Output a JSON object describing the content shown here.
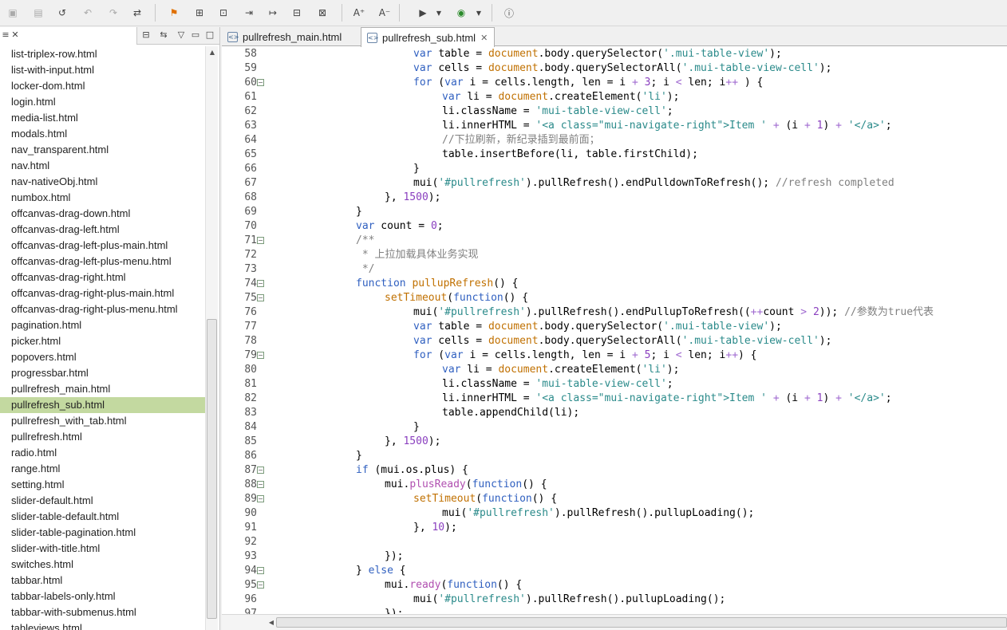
{
  "toolbar": {
    "icons": [
      "save-icon",
      "save-all-icon",
      "revert-icon",
      "undo-icon",
      "redo-icon",
      "format-icon",
      "bookmark-icon",
      "new-file-icon",
      "export-icon",
      "step-in-icon",
      "step-out-icon",
      "terminal-icon",
      "disabled-icon",
      "font-increase-icon",
      "font-decrease-icon",
      "run-icon",
      "browser-icon",
      "info-icon"
    ],
    "glyph_increase": "A⁺",
    "glyph_decrease": "A⁻"
  },
  "left": {
    "files": [
      "list-triplex-row.html",
      "list-with-input.html",
      "locker-dom.html",
      "login.html",
      "media-list.html",
      "modals.html",
      "nav_transparent.html",
      "nav.html",
      "nav-nativeObj.html",
      "numbox.html",
      "offcanvas-drag-down.html",
      "offcanvas-drag-left.html",
      "offcanvas-drag-left-plus-main.html",
      "offcanvas-drag-left-plus-menu.html",
      "offcanvas-drag-right.html",
      "offcanvas-drag-right-plus-main.html",
      "offcanvas-drag-right-plus-menu.html",
      "pagination.html",
      "picker.html",
      "popovers.html",
      "progressbar.html",
      "pullrefresh_main.html",
      "pullrefresh_sub.html",
      "pullrefresh_with_tab.html",
      "pullrefresh.html",
      "radio.html",
      "range.html",
      "setting.html",
      "slider-default.html",
      "slider-table-default.html",
      "slider-table-pagination.html",
      "slider-with-title.html",
      "switches.html",
      "tabbar.html",
      "tabbar-labels-only.html",
      "tabbar-with-submenus.html",
      "tableviews.html"
    ],
    "selected": 22
  },
  "editor": {
    "tabs": [
      "pullrefresh_main.html",
      "pullrefresh_sub.html"
    ],
    "active_tab": 1,
    "lines": [
      {
        "n": "58",
        "fold": false,
        "i": 10,
        "t": [
          [
            "k",
            "var"
          ],
          [
            "",
            "table = "
          ],
          [
            "f",
            "document"
          ],
          [
            "",
            ".body.querySelector("
          ],
          [
            "s",
            "'.mui-table-view'"
          ],
          [
            "",
            ");"
          ]
        ]
      },
      {
        "n": "59",
        "fold": false,
        "i": 10,
        "t": [
          [
            "k",
            "var"
          ],
          [
            "",
            "cells = "
          ],
          [
            "f",
            "document"
          ],
          [
            "",
            ".body.querySelectorAll("
          ],
          [
            "s",
            "'.mui-table-view-cell'"
          ],
          [
            "",
            ");"
          ]
        ]
      },
      {
        "n": "60",
        "fold": true,
        "i": 10,
        "t": [
          [
            "k",
            "for"
          ],
          [
            "",
            " ("
          ],
          [
            "k",
            "var"
          ],
          [
            "",
            " i = cells.length, len = i "
          ],
          [
            "o",
            "+"
          ],
          [
            "",
            " "
          ],
          [
            "n",
            "3"
          ],
          [
            "",
            "; i "
          ],
          [
            "o",
            "<"
          ],
          [
            "",
            " len; i"
          ],
          [
            "o",
            "++"
          ],
          [
            "",
            " ) {"
          ]
        ]
      },
      {
        "n": "61",
        "fold": false,
        "i": 12,
        "t": [
          [
            "k",
            "var"
          ],
          [
            "",
            "li = "
          ],
          [
            "f",
            "document"
          ],
          [
            "",
            ".createElement("
          ],
          [
            "s",
            "'li'"
          ],
          [
            "",
            ");"
          ]
        ]
      },
      {
        "n": "62",
        "fold": false,
        "i": 12,
        "t": [
          [
            "",
            "li.className = "
          ],
          [
            "s",
            "'mui-table-view-cell'"
          ],
          [
            "",
            ";"
          ]
        ]
      },
      {
        "n": "63",
        "fold": false,
        "i": 12,
        "t": [
          [
            "",
            "li.innerHTML = "
          ],
          [
            "s",
            "'<a class=\"mui-navigate-right\">Item '"
          ],
          [
            "",
            " "
          ],
          [
            "o",
            "+"
          ],
          [
            "",
            " (i "
          ],
          [
            "o",
            "+"
          ],
          [
            "",
            " "
          ],
          [
            "n",
            "1"
          ],
          [
            "",
            ") "
          ],
          [
            "o",
            "+"
          ],
          [
            "",
            " "
          ],
          [
            "s",
            "'</a>'"
          ],
          [
            "",
            ";"
          ]
        ]
      },
      {
        "n": "64",
        "fold": false,
        "i": 12,
        "t": [
          [
            "c",
            "//下拉刷新，新纪录插到最前面；"
          ]
        ]
      },
      {
        "n": "65",
        "fold": false,
        "i": 12,
        "t": [
          [
            "",
            "table.insertBefore(li, table.firstChild);"
          ]
        ]
      },
      {
        "n": "66",
        "fold": false,
        "i": 10,
        "t": [
          [
            "",
            "}"
          ]
        ]
      },
      {
        "n": "67",
        "fold": false,
        "i": 10,
        "t": [
          [
            "",
            "mui("
          ],
          [
            "s",
            "'#pullrefresh'"
          ],
          [
            "",
            ").pullRefresh().endPulldownToRefresh(); "
          ],
          [
            "c",
            "//refresh completed"
          ]
        ]
      },
      {
        "n": "68",
        "fold": false,
        "i": 8,
        "t": [
          [
            "",
            "}, "
          ],
          [
            "n",
            "1500"
          ],
          [
            "",
            ");"
          ]
        ]
      },
      {
        "n": "69",
        "fold": false,
        "i": 6,
        "t": [
          [
            "",
            "}"
          ]
        ]
      },
      {
        "n": "70",
        "fold": false,
        "i": 6,
        "t": [
          [
            "k",
            "var"
          ],
          [
            "",
            " count = "
          ],
          [
            "n",
            "0"
          ],
          [
            "",
            ";"
          ]
        ]
      },
      {
        "n": "71",
        "fold": true,
        "i": 6,
        "t": [
          [
            "c",
            "/**"
          ]
        ]
      },
      {
        "n": "72",
        "fold": false,
        "i": 6,
        "t": [
          [
            "c",
            " * 上拉加载具体业务实现"
          ]
        ]
      },
      {
        "n": "73",
        "fold": false,
        "i": 6,
        "t": [
          [
            "c",
            " */"
          ]
        ]
      },
      {
        "n": "74",
        "fold": true,
        "i": 6,
        "t": [
          [
            "k",
            "function"
          ],
          [
            "",
            " "
          ],
          [
            "f",
            "pullupRefresh"
          ],
          [
            "",
            "() {"
          ]
        ]
      },
      {
        "n": "75",
        "fold": true,
        "i": 8,
        "t": [
          [
            "f",
            "setTimeout"
          ],
          [
            "",
            "("
          ],
          [
            "k",
            "function"
          ],
          [
            "",
            "() {"
          ]
        ]
      },
      {
        "n": "76",
        "fold": false,
        "i": 10,
        "t": [
          [
            "",
            "mui("
          ],
          [
            "s",
            "'#pullrefresh'"
          ],
          [
            "",
            ").pullRefresh().endPullupToRefresh(("
          ],
          [
            "o",
            "++"
          ],
          [
            "",
            "count "
          ],
          [
            "o",
            ">"
          ],
          [
            "",
            " "
          ],
          [
            "n",
            "2"
          ],
          [
            "",
            "));"
          ],
          [
            "",
            " "
          ],
          [
            "c",
            "//参数为true代表"
          ]
        ]
      },
      {
        "n": "77",
        "fold": false,
        "i": 10,
        "t": [
          [
            "k",
            "var"
          ],
          [
            "",
            " table = "
          ],
          [
            "f",
            "document"
          ],
          [
            "",
            ".body.querySelector("
          ],
          [
            "s",
            "'.mui-table-view'"
          ],
          [
            "",
            ");"
          ]
        ]
      },
      {
        "n": "78",
        "fold": false,
        "i": 10,
        "t": [
          [
            "k",
            "var"
          ],
          [
            "",
            " cells = "
          ],
          [
            "f",
            "document"
          ],
          [
            "",
            ".body.querySelectorAll("
          ],
          [
            "s",
            "'.mui-table-view-cell'"
          ],
          [
            "",
            ");"
          ]
        ]
      },
      {
        "n": "79",
        "fold": true,
        "i": 10,
        "t": [
          [
            "k",
            "for"
          ],
          [
            "",
            " ("
          ],
          [
            "k",
            "var"
          ],
          [
            "",
            " i = cells.length, len = i "
          ],
          [
            "o",
            "+"
          ],
          [
            "",
            " "
          ],
          [
            "n",
            "5"
          ],
          [
            "",
            "; i "
          ],
          [
            "o",
            "<"
          ],
          [
            "",
            " len; i"
          ],
          [
            "o",
            "++"
          ],
          [
            "",
            ") {"
          ]
        ]
      },
      {
        "n": "80",
        "fold": false,
        "i": 12,
        "t": [
          [
            "k",
            "var"
          ],
          [
            "",
            " li = "
          ],
          [
            "f",
            "document"
          ],
          [
            "",
            ".createElement("
          ],
          [
            "s",
            "'li'"
          ],
          [
            "",
            ");"
          ]
        ]
      },
      {
        "n": "81",
        "fold": false,
        "i": 12,
        "t": [
          [
            "",
            "li.className = "
          ],
          [
            "s",
            "'mui-table-view-cell'"
          ],
          [
            "",
            ";"
          ]
        ]
      },
      {
        "n": "82",
        "fold": false,
        "i": 12,
        "t": [
          [
            "",
            "li.innerHTML = "
          ],
          [
            "s",
            "'<a class=\"mui-navigate-right\">Item '"
          ],
          [
            "",
            " "
          ],
          [
            "o",
            "+"
          ],
          [
            "",
            " (i "
          ],
          [
            "o",
            "+"
          ],
          [
            "",
            " "
          ],
          [
            "n",
            "1"
          ],
          [
            "",
            ") "
          ],
          [
            "o",
            "+"
          ],
          [
            "",
            " "
          ],
          [
            "s",
            "'</a>'"
          ],
          [
            "",
            ";"
          ]
        ]
      },
      {
        "n": "83",
        "fold": false,
        "i": 12,
        "t": [
          [
            "",
            "table.appendChild(li);"
          ]
        ]
      },
      {
        "n": "84",
        "fold": false,
        "i": 10,
        "t": [
          [
            "",
            "}"
          ]
        ]
      },
      {
        "n": "85",
        "fold": false,
        "i": 8,
        "t": [
          [
            "",
            "}, "
          ],
          [
            "n",
            "1500"
          ],
          [
            "",
            ");"
          ]
        ]
      },
      {
        "n": "86",
        "fold": false,
        "i": 6,
        "t": [
          [
            "",
            "}"
          ]
        ]
      },
      {
        "n": "87",
        "fold": true,
        "i": 6,
        "t": [
          [
            "k",
            "if"
          ],
          [
            "",
            " (mui.os.plus) {"
          ]
        ]
      },
      {
        "n": "88",
        "fold": true,
        "i": 8,
        "t": [
          [
            "",
            "mui."
          ],
          [
            "fn",
            "plusReady"
          ],
          [
            "",
            "("
          ],
          [
            "k",
            "function"
          ],
          [
            "",
            "() {"
          ]
        ]
      },
      {
        "n": "89",
        "fold": true,
        "i": 10,
        "t": [
          [
            "f",
            "setTimeout"
          ],
          [
            "",
            "("
          ],
          [
            "k",
            "function"
          ],
          [
            "",
            "() {"
          ]
        ]
      },
      {
        "n": "90",
        "fold": false,
        "i": 12,
        "t": [
          [
            "",
            "mui("
          ],
          [
            "s",
            "'#pullrefresh'"
          ],
          [
            "",
            ").pullRefresh().pullupLoading();"
          ]
        ]
      },
      {
        "n": "91",
        "fold": false,
        "i": 10,
        "t": [
          [
            "",
            "}, "
          ],
          [
            "n",
            "10"
          ],
          [
            "",
            ");"
          ]
        ]
      },
      {
        "n": "92",
        "fold": false,
        "i": 6,
        "t": []
      },
      {
        "n": "93",
        "fold": false,
        "i": 8,
        "t": [
          [
            "",
            "});"
          ]
        ]
      },
      {
        "n": "94",
        "fold": true,
        "i": 6,
        "t": [
          [
            "",
            "} "
          ],
          [
            "k",
            "else"
          ],
          [
            "",
            " {"
          ]
        ]
      },
      {
        "n": "95",
        "fold": true,
        "i": 8,
        "t": [
          [
            "",
            "mui."
          ],
          [
            "fn",
            "ready"
          ],
          [
            "",
            "("
          ],
          [
            "k",
            "function"
          ],
          [
            "",
            "() {"
          ]
        ]
      },
      {
        "n": "96",
        "fold": false,
        "i": 10,
        "t": [
          [
            "",
            "mui("
          ],
          [
            "s",
            "'#pullrefresh'"
          ],
          [
            "",
            ").pullRefresh().pullupLoading();"
          ]
        ]
      },
      {
        "n": "97",
        "fold": false,
        "i": 8,
        "t": [
          [
            "",
            "});"
          ]
        ]
      }
    ]
  }
}
